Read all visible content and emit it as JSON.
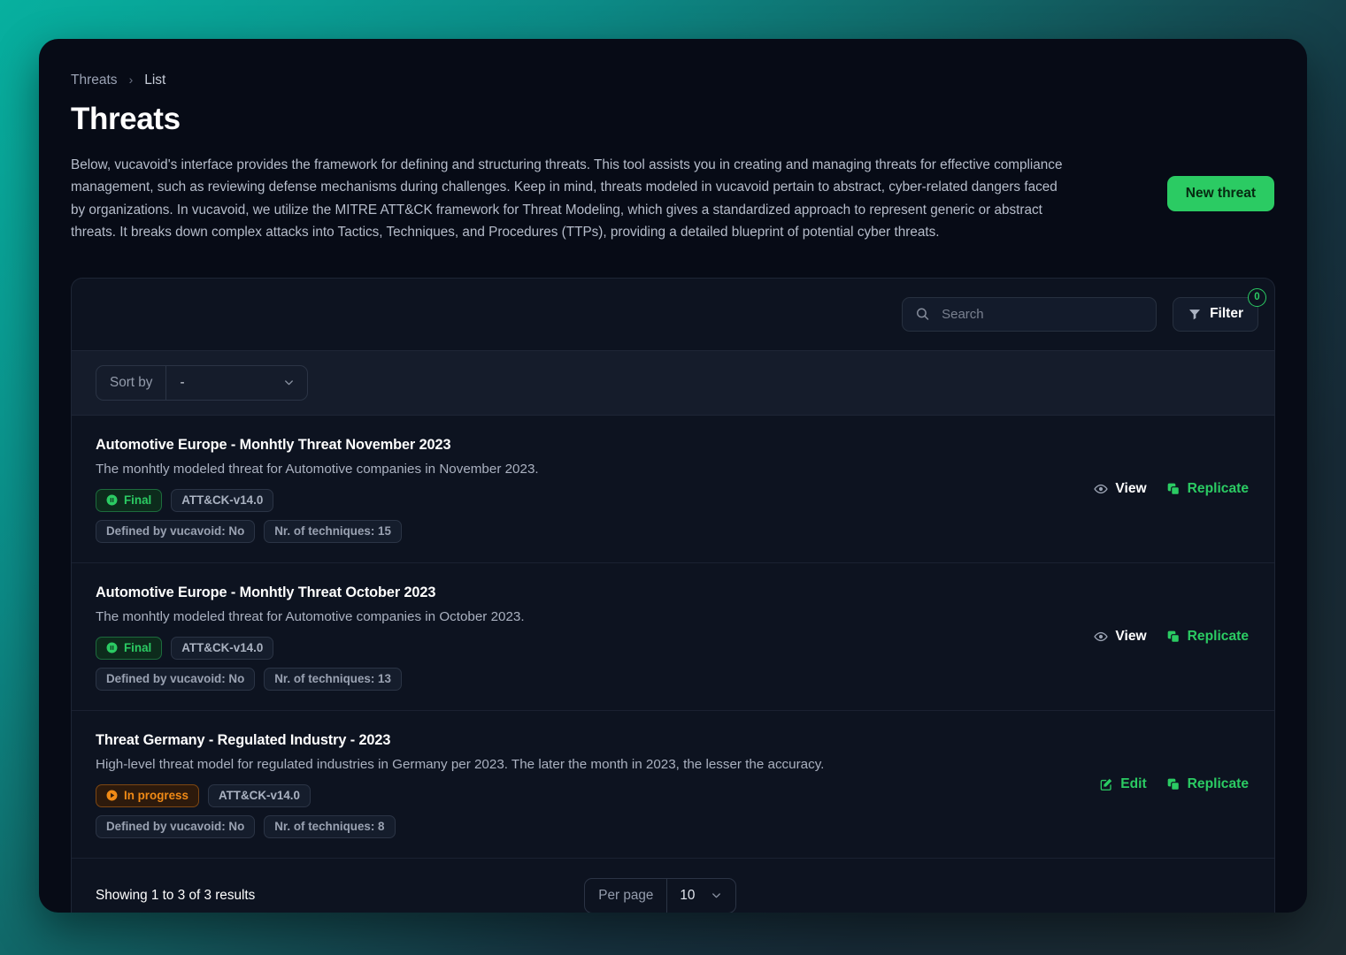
{
  "breadcrumb": {
    "root": "Threats",
    "separator": "›",
    "current": "List"
  },
  "header": {
    "title": "Threats",
    "description": "Below, vucavoid's interface provides the framework for defining and structuring threats. This tool assists you in creating and managing threats for effective compliance management, such as reviewing defense mechanisms during challenges. Keep in mind, threats modeled in vucavoid pertain to abstract, cyber-related dangers faced by organizations. In vucavoid, we utilize the MITRE ATT&CK framework for Threat Modeling, which gives a standardized approach to represent generic or abstract threats. It breaks down complex attacks into Tactics, Techniques, and Procedures (TTPs), providing a detailed blueprint of potential cyber threats.",
    "new_threat_label": "New threat"
  },
  "toolbar": {
    "search_placeholder": "Search",
    "search_value": "",
    "search_icon": "search-icon",
    "filter_label": "Filter",
    "filter_icon": "funnel-icon",
    "filter_count": "0"
  },
  "sort": {
    "label": "Sort by",
    "value": "-",
    "chevron_icon": "chevron-down-icon"
  },
  "rows": [
    {
      "title": "Automotive Europe - Monhtly Threat November 2023",
      "description": "The monhtly modeled threat for Automotive companies in November 2023.",
      "status": {
        "label": "Final",
        "icon": "pause-circle-icon",
        "kind": "final"
      },
      "framework": "ATT&CK-v14.0",
      "defined_by": "Defined by vucavoid: No",
      "techniques": "Nr. of techniques: 15",
      "actions": [
        {
          "label": "View",
          "icon": "eye-icon",
          "style": "view"
        },
        {
          "label": "Replicate",
          "icon": "copy-icon",
          "style": "green"
        }
      ]
    },
    {
      "title": "Automotive Europe - Monhtly Threat October 2023",
      "description": "The monhtly modeled threat for Automotive companies in October 2023.",
      "status": {
        "label": "Final",
        "icon": "pause-circle-icon",
        "kind": "final"
      },
      "framework": "ATT&CK-v14.0",
      "defined_by": "Defined by vucavoid: No",
      "techniques": "Nr. of techniques: 13",
      "actions": [
        {
          "label": "View",
          "icon": "eye-icon",
          "style": "view"
        },
        {
          "label": "Replicate",
          "icon": "copy-icon",
          "style": "green"
        }
      ]
    },
    {
      "title": "Threat Germany - Regulated Industry - 2023",
      "description": "High-level threat model for regulated industries in Germany per 2023. The later the month in 2023, the lesser the accuracy.",
      "status": {
        "label": "In progress",
        "icon": "play-circle-icon",
        "kind": "progress"
      },
      "framework": "ATT&CK-v14.0",
      "defined_by": "Defined by vucavoid: No",
      "techniques": "Nr. of techniques: 8",
      "actions": [
        {
          "label": "Edit",
          "icon": "pencil-square-icon",
          "style": "green"
        },
        {
          "label": "Replicate",
          "icon": "copy-icon",
          "style": "green"
        }
      ]
    }
  ],
  "footer": {
    "showing": "Showing 1 to 3 of 3 results",
    "per_page_label": "Per page",
    "per_page_value": "10",
    "chevron_icon": "chevron-down-icon"
  },
  "colors": {
    "accent_green": "#2bcb63",
    "status_orange": "#f08a16",
    "card_bg": "#070b16",
    "panel_bg": "#0d1320",
    "background_start": "#07b09f",
    "background_end": "#1d2b31"
  }
}
